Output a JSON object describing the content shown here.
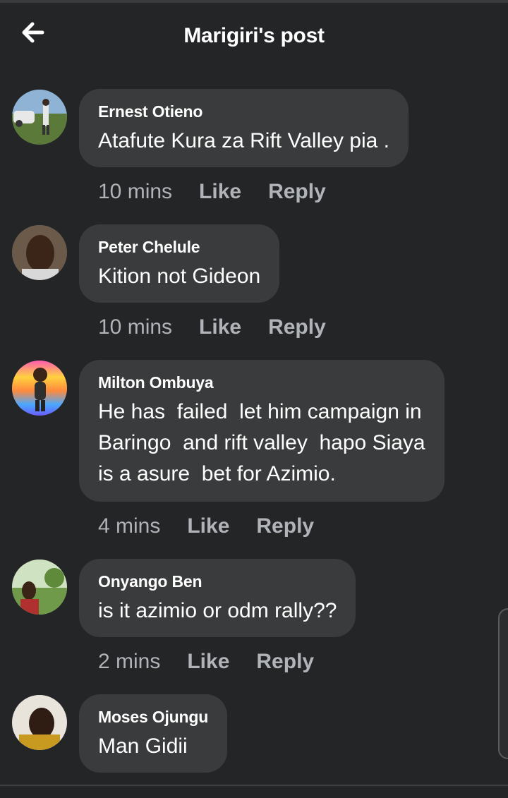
{
  "header": {
    "title": "Marigiri's post",
    "back_icon": "arrow-left-icon"
  },
  "comments": [
    {
      "author": "Ernest Otieno",
      "text": "Atafute Kura za Rift Valley pia .",
      "time": "10 mins",
      "like": "Like",
      "reply": "Reply"
    },
    {
      "author": "Peter Chelule",
      "text": "Kition not Gideon",
      "time": "10 mins",
      "like": "Like",
      "reply": "Reply"
    },
    {
      "author": "Milton Ombuya",
      "text": "He has  failed  let him campaign in\nBaringo  and rift valley  hapo Siaya\nis a asure  bet for Azimio.",
      "time": "4 mins",
      "like": "Like",
      "reply": "Reply"
    },
    {
      "author": "Onyango Ben",
      "text": "is it azimio or odm rally??",
      "time": "2 mins",
      "like": "Like",
      "reply": "Reply"
    },
    {
      "author": "Moses Ojungu",
      "text": "Man Gidii"
    }
  ],
  "colors": {
    "background": "#242527",
    "bubble": "#3a3b3c",
    "meta_text": "#b0b3b8",
    "text": "#ffffff"
  }
}
